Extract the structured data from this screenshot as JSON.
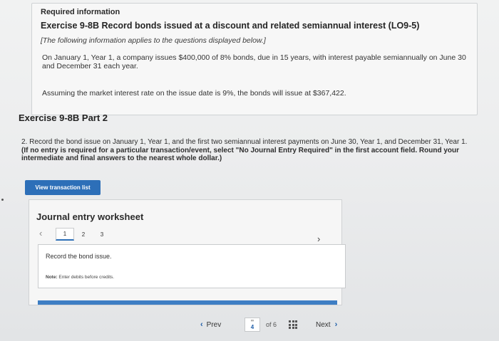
{
  "required": {
    "title": "Required information",
    "exercise": "Exercise 9-8B Record bonds issued at a discount and related semiannual interest (LO9-5)",
    "italic_note": "[The following information applies to the questions displayed below.]",
    "paragraph": "On January 1, Year 1, a company issues $400,000 of 8% bonds, due in 15 years, with interest payable semiannually on June 30 and December 31 each year.",
    "assumption": "Assuming the market interest rate on the issue date is 9%, the bonds will issue at $367,422."
  },
  "part": {
    "title": "Exercise 9-8B Part 2"
  },
  "instructions": {
    "normal": "2. Record the bond issue on January 1, Year 1, and the first two semiannual interest payments on June 30, Year 1, and December 31, Year 1.",
    "bold": "(If no entry is required for a particular transaction/event, select \"No Journal Entry Required\" in the first account field. Round your intermediate and final answers to the nearest whole dollar.)"
  },
  "view_transaction_button": "View transaction list",
  "worksheet": {
    "title": "Journal entry worksheet",
    "prev_icon": "chevron-left-icon",
    "next_icon": "chevron-right-icon",
    "pages": [
      "1",
      "2",
      "3"
    ],
    "active_page": "1",
    "record_text": "Record the bond issue.",
    "note_label": "Note:",
    "note_text": "Enter debits before credits."
  },
  "nav": {
    "prev_label": "Prev",
    "current_page": "4",
    "of_text": "of 6",
    "next_label": "Next",
    "link_icon": "link-icon",
    "grid_icon": "grid-icon"
  },
  "colors": {
    "accent": "#2d6fb8",
    "page_background": "#eceded",
    "panel_background": "#f7f7f7"
  }
}
